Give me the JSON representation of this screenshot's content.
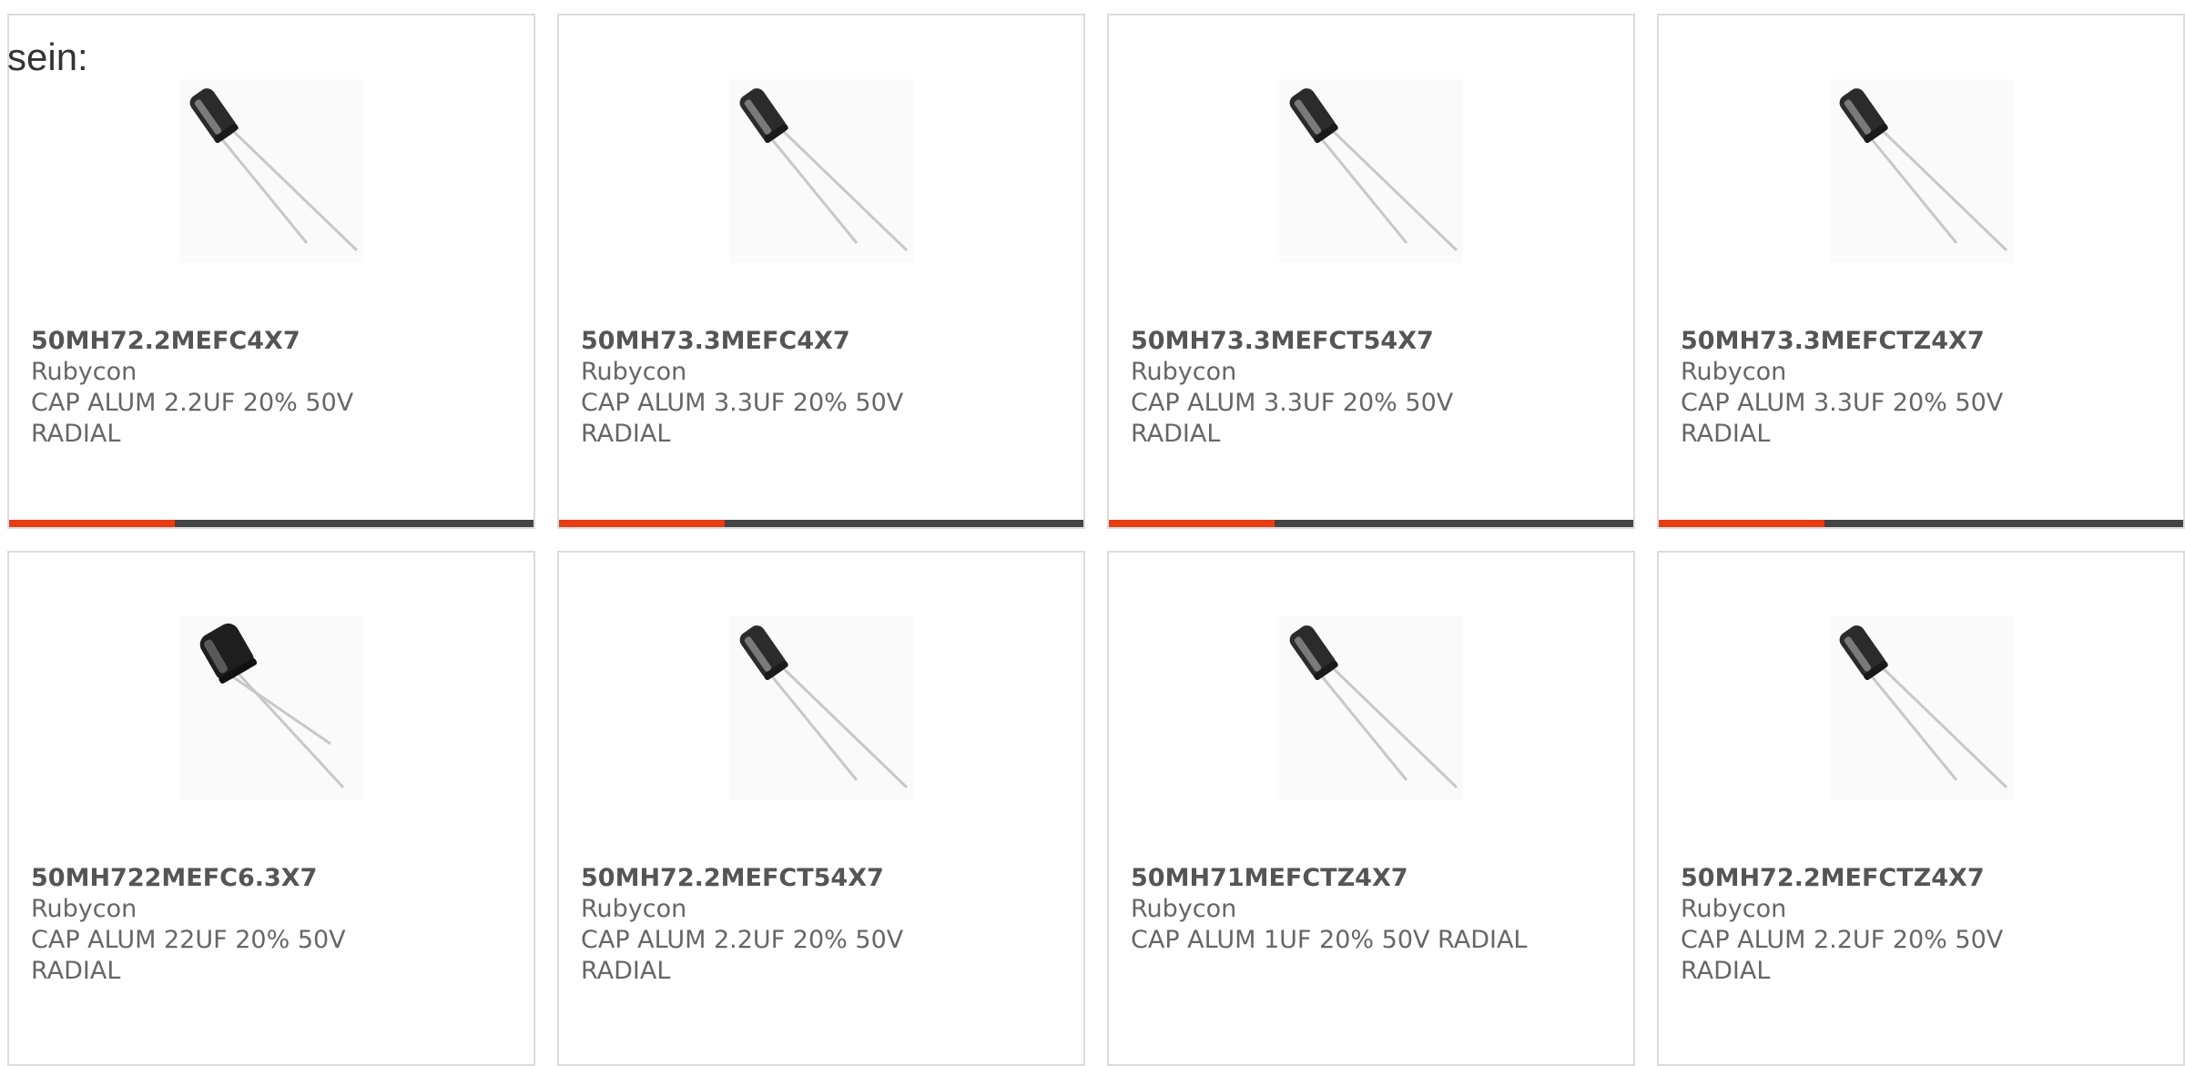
{
  "intro_text": "sein:",
  "colors": {
    "accent": "#e83c14",
    "bar": "#444444",
    "card_border": "#dcdcdc",
    "text": "#666666"
  },
  "products": [
    {
      "part": "50MH72.2MEFC4X7",
      "brand": "Rubycon",
      "desc1": "CAP ALUM 2.2UF 20% 50V",
      "desc2": "RADIAL",
      "image_icon": "capacitor-image"
    },
    {
      "part": "50MH73.3MEFC4X7",
      "brand": "Rubycon",
      "desc1": "CAP ALUM 3.3UF 20% 50V",
      "desc2": "RADIAL",
      "image_icon": "capacitor-image"
    },
    {
      "part": "50MH73.3MEFCT54X7",
      "brand": "Rubycon",
      "desc1": "CAP ALUM 3.3UF 20% 50V",
      "desc2": "RADIAL",
      "image_icon": "capacitor-image"
    },
    {
      "part": "50MH73.3MEFCTZ4X7",
      "brand": "Rubycon",
      "desc1": "CAP ALUM 3.3UF 20% 50V",
      "desc2": "RADIAL",
      "image_icon": "capacitor-image"
    },
    {
      "part": "50MH722MEFC6.3X7",
      "brand": "Rubycon",
      "desc1": "CAP ALUM 22UF 20% 50V",
      "desc2": "RADIAL",
      "image_icon": "capacitor-image"
    },
    {
      "part": "50MH72.2MEFCT54X7",
      "brand": "Rubycon",
      "desc1": "CAP ALUM 2.2UF 20% 50V",
      "desc2": "RADIAL",
      "image_icon": "capacitor-image"
    },
    {
      "part": "50MH71MEFCTZ4X7",
      "brand": "Rubycon",
      "desc1": "CAP ALUM 1UF 20% 50V RADIAL",
      "desc2": "",
      "image_icon": "capacitor-image"
    },
    {
      "part": "50MH72.2MEFCTZ4X7",
      "brand": "Rubycon",
      "desc1": "CAP ALUM 2.2UF 20% 50V",
      "desc2": "RADIAL",
      "image_icon": "capacitor-image"
    }
  ]
}
